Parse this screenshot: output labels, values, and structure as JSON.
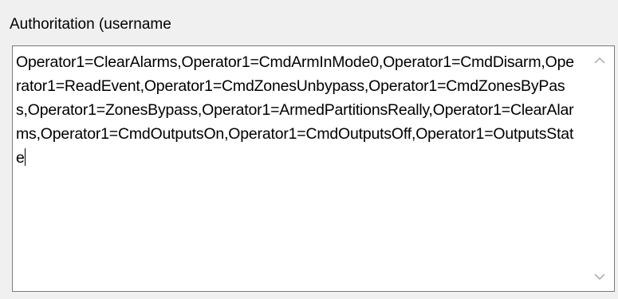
{
  "group": {
    "label": "Authoritation (username"
  },
  "textarea": {
    "value": "Operator1=ClearAlarms,Operator1=CmdArmInMode0,Operator1=CmdDisarm,Operator1=ReadEvent,Operator1=CmdZonesUnbypass,Operator1=CmdZonesByPass,Operator1=ZonesBypass,Operator1=ArmedPartitionsReally,Operator1=ClearAlarms,Operator1=CmdOutputsOn,Operator1=CmdOutputsOff,Operator1=OutputsState"
  },
  "scrollbar": {
    "up_icon": "chevron-up-icon",
    "down_icon": "chevron-down-icon",
    "arrow_color": "#a0a0a0"
  },
  "colors": {
    "window_bg": "#f0f0f0",
    "field_bg": "#ffffff",
    "field_border": "#7a7a7a"
  }
}
